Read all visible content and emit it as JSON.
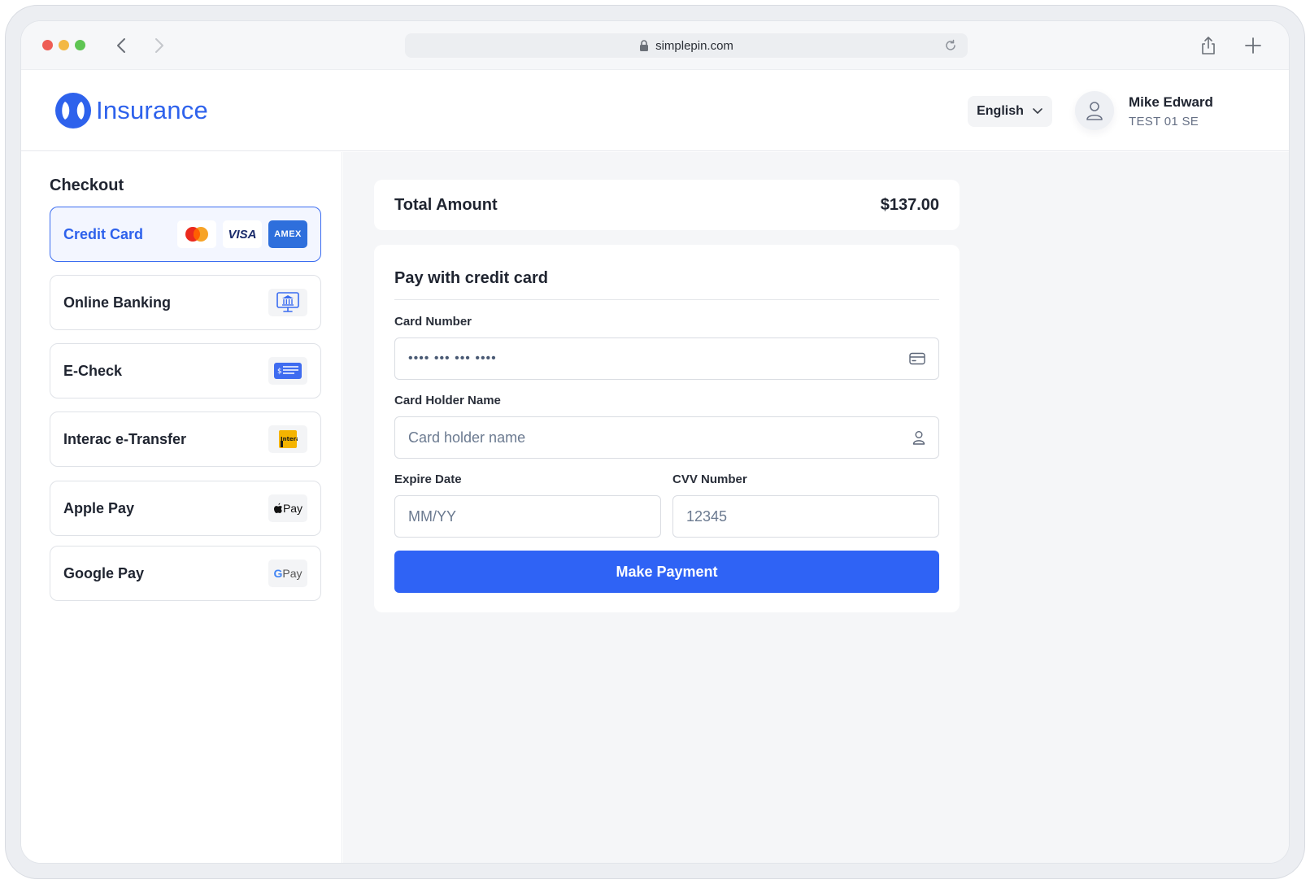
{
  "browser": {
    "url": "simplepin.com"
  },
  "header": {
    "brand": "Insurance",
    "language": "English",
    "user_name": "Mike Edward",
    "user_sub": "TEST 01 SE"
  },
  "sidebar": {
    "title": "Checkout",
    "methods": [
      {
        "label": "Credit Card",
        "badges": [
          "mastercard",
          "VISA",
          "AMEX"
        ]
      },
      {
        "label": "Online Banking",
        "icon": "bank-screen-icon"
      },
      {
        "label": "E-Check",
        "icon": "check-icon"
      },
      {
        "label": "Interac e-Transfer",
        "icon": "interac-icon",
        "badge_text": "Interac"
      },
      {
        "label": "Apple Pay",
        "badge_text": "Pay"
      },
      {
        "label": "Google Pay",
        "badge_g": "G",
        "badge_text": "Pay"
      }
    ]
  },
  "summary": {
    "label": "Total Amount",
    "value": "$137.00"
  },
  "form": {
    "title": "Pay with credit card",
    "card_number_label": "Card Number",
    "card_number_value": "•••• ••• ••• ••••",
    "holder_label": "Card Holder Name",
    "holder_placeholder": "Card holder name",
    "expire_label": "Expire Date",
    "expire_placeholder": "MM/YY",
    "cvv_label": "CVV Number",
    "cvv_placeholder": "12345",
    "submit": "Make Payment"
  },
  "colors": {
    "accent": "#2f63f5",
    "brand": "#2e62ec",
    "amex": "#2e6fdc",
    "interac": "#f5b400"
  }
}
